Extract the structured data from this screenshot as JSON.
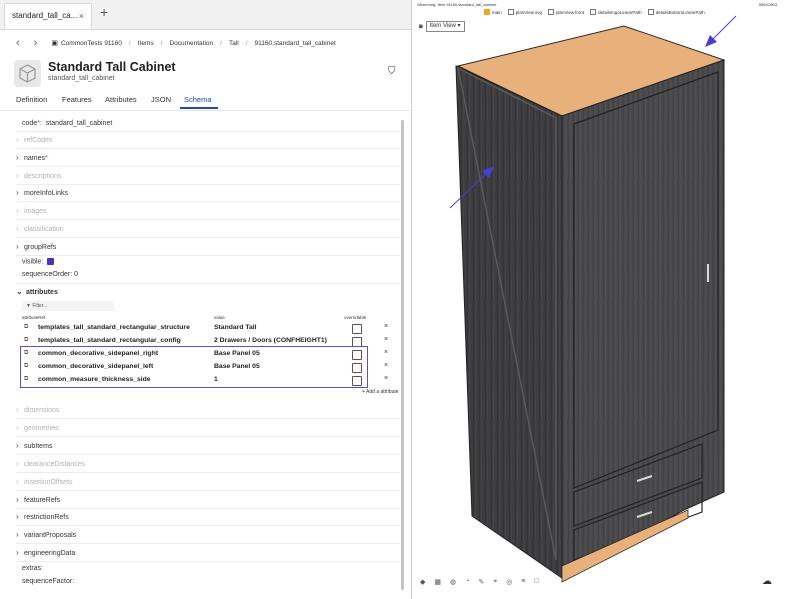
{
  "tab": {
    "label": "standard_tall_ca...",
    "close": "×",
    "new": "+"
  },
  "breadcrumb": {
    "back": "‹",
    "forward": "›",
    "items": [
      "CommonTests 91160",
      "Items",
      "Documentation",
      "Tall",
      "91160.standard_tall_cabinet"
    ]
  },
  "header": {
    "title": "Standard Tall Cabinet",
    "subtitle": "standard_tall_cabinet"
  },
  "tabs": [
    "Definition",
    "Features",
    "Attributes",
    "JSON",
    "Schema"
  ],
  "active_tab": "Schema",
  "schema": {
    "code_label": "code",
    "code_req": "*",
    "code_value": "standard_tall_cabinet",
    "rows1": [
      {
        "label": "refCodes",
        "dim": true,
        "req": ""
      },
      {
        "label": "names",
        "dim": false,
        "req": "*"
      },
      {
        "label": "descriptions",
        "dim": true,
        "req": ""
      },
      {
        "label": "moreInfoLinks",
        "dim": false,
        "req": ""
      },
      {
        "label": "images",
        "dim": true,
        "req": ""
      },
      {
        "label": "classification",
        "dim": true,
        "req": ""
      },
      {
        "label": "groupRefs",
        "dim": false,
        "req": ""
      }
    ],
    "visible_label": "visible:",
    "sequence_order_label": "sequenceOrder:",
    "sequence_order_value": "0",
    "attributes_label": "attributes",
    "filter_placeholder": "Filter...",
    "columns": [
      "attributeRef",
      "value",
      "overridable"
    ],
    "attribute_rows": [
      {
        "ref": "templates_tall_standard_rectangular_structure",
        "value": "Standard Tall"
      },
      {
        "ref": "templates_tall_standard_rectangular_config",
        "value": "2 Drawers / Doors (CONFHEIGHT1)"
      },
      {
        "ref": "common_decorative_sidepanel_right",
        "value": "Base Panel 05"
      },
      {
        "ref": "common_decorative_sidepanel_left",
        "value": "Base Panel 05"
      },
      {
        "ref": "common_measure_thickness_side",
        "value": "1"
      }
    ],
    "add_attribute": "+ Add a attribute",
    "rows2": [
      {
        "label": "dimensions",
        "dim": true
      },
      {
        "label": "geometries",
        "dim": true
      },
      {
        "label": "subItems",
        "dim": false
      },
      {
        "label": "clearanceDistances",
        "dim": true
      },
      {
        "label": "insertionOffsets",
        "dim": true
      },
      {
        "label": "featureRefs",
        "dim": false
      },
      {
        "label": "restrictionRefs",
        "dim": false
      },
      {
        "label": "variantProposals",
        "dim": false
      },
      {
        "label": "engineeringData",
        "dim": false
      }
    ],
    "extras_label": "extras:",
    "sequence_factor_label": "sequenceFactor:"
  },
  "viewer": {
    "observing": "Observing: Item 91160.standard_tall_cabinet",
    "right_info": "956X2803",
    "checkboxes": [
      {
        "label": "main",
        "checked": true
      },
      {
        "label": "planView.svg",
        "checked": false
      },
      {
        "label": "planView.front",
        "checked": false
      },
      {
        "label": "detailsIngoLinearPath",
        "checked": false
      },
      {
        "label": "detailsBottomLinearPath",
        "checked": false
      }
    ],
    "view_select": "Item View",
    "colors": {
      "carcass": "#3a3a3c",
      "top": "#e8b07a",
      "arrow": "#4a3fd0",
      "highlight": "#5c4fc7"
    }
  }
}
